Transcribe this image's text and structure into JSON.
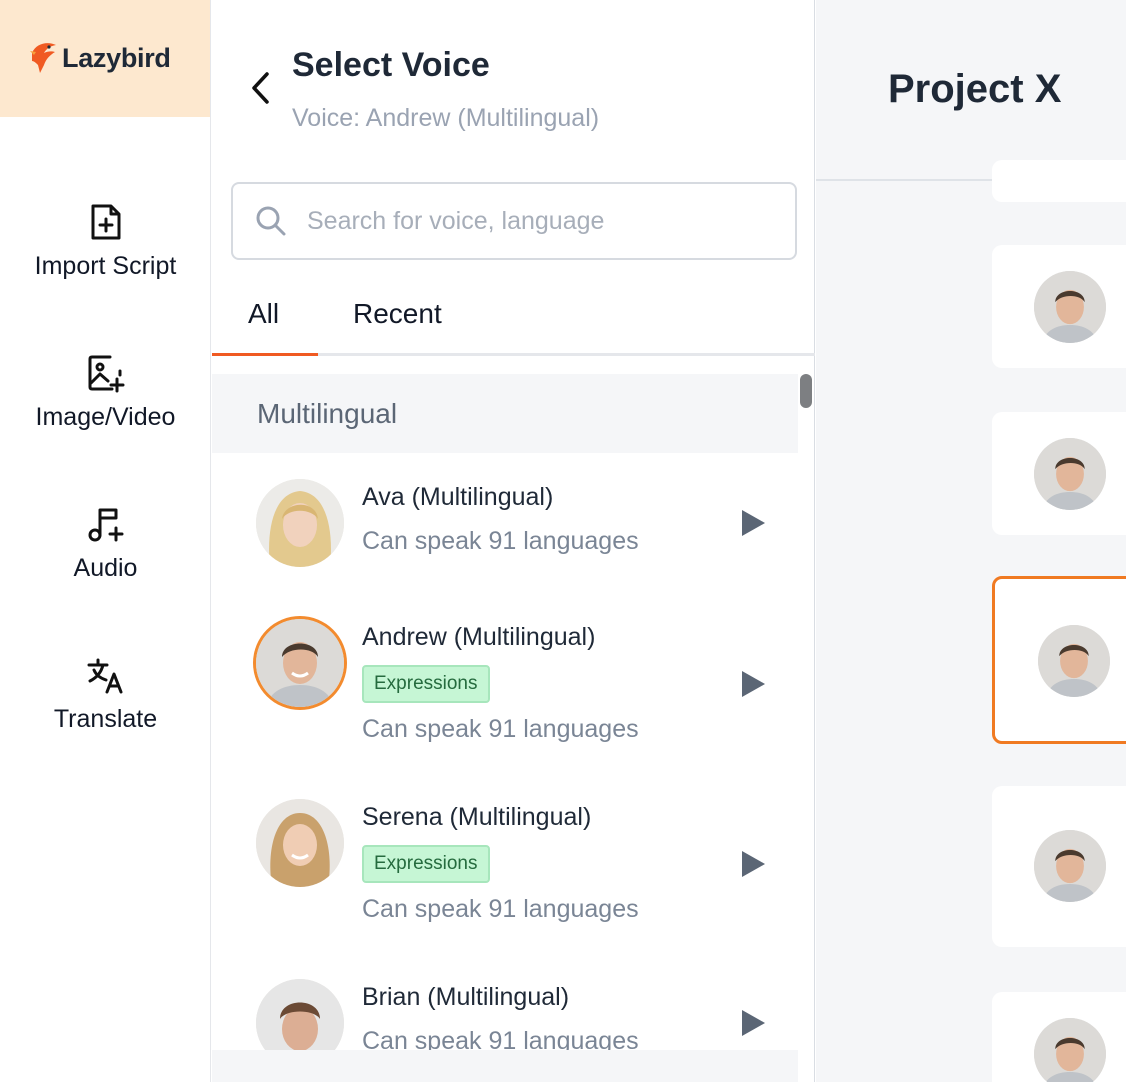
{
  "brand": {
    "name": "Lazybird",
    "accent": "#f05a22"
  },
  "nav": {
    "items": [
      {
        "label": "Import Script",
        "icon": "file-plus-icon"
      },
      {
        "label": "Image/Video",
        "icon": "image-plus-icon"
      },
      {
        "label": "Audio",
        "icon": "music-plus-icon"
      },
      {
        "label": "Translate",
        "icon": "translate-icon"
      }
    ]
  },
  "panel": {
    "title": "Select Voice",
    "subtitle": "Voice: Andrew (Multilingual)",
    "search_placeholder": "Search for voice, language",
    "tabs": [
      {
        "label": "All"
      },
      {
        "label": "Recent"
      }
    ],
    "group_label": "Multilingual",
    "voices": [
      {
        "name": "Ava (Multilingual)",
        "badge": "",
        "desc": "Can speak 91 languages",
        "selected": false
      },
      {
        "name": "Andrew (Multilingual)",
        "badge": "Expressions",
        "desc": "Can speak 91 languages",
        "selected": true
      },
      {
        "name": "Serena (Multilingual)",
        "badge": "Expressions",
        "desc": "Can speak 91 languages",
        "selected": false
      },
      {
        "name": "Brian (Multilingual)",
        "badge": "",
        "desc": "Can speak 91 languages",
        "selected": false
      }
    ]
  },
  "project": {
    "title": "Project X"
  },
  "colors": {
    "selected_ring": "#f38b2e",
    "badge_bg": "#c6f6d5",
    "badge_text": "#256b3e"
  }
}
